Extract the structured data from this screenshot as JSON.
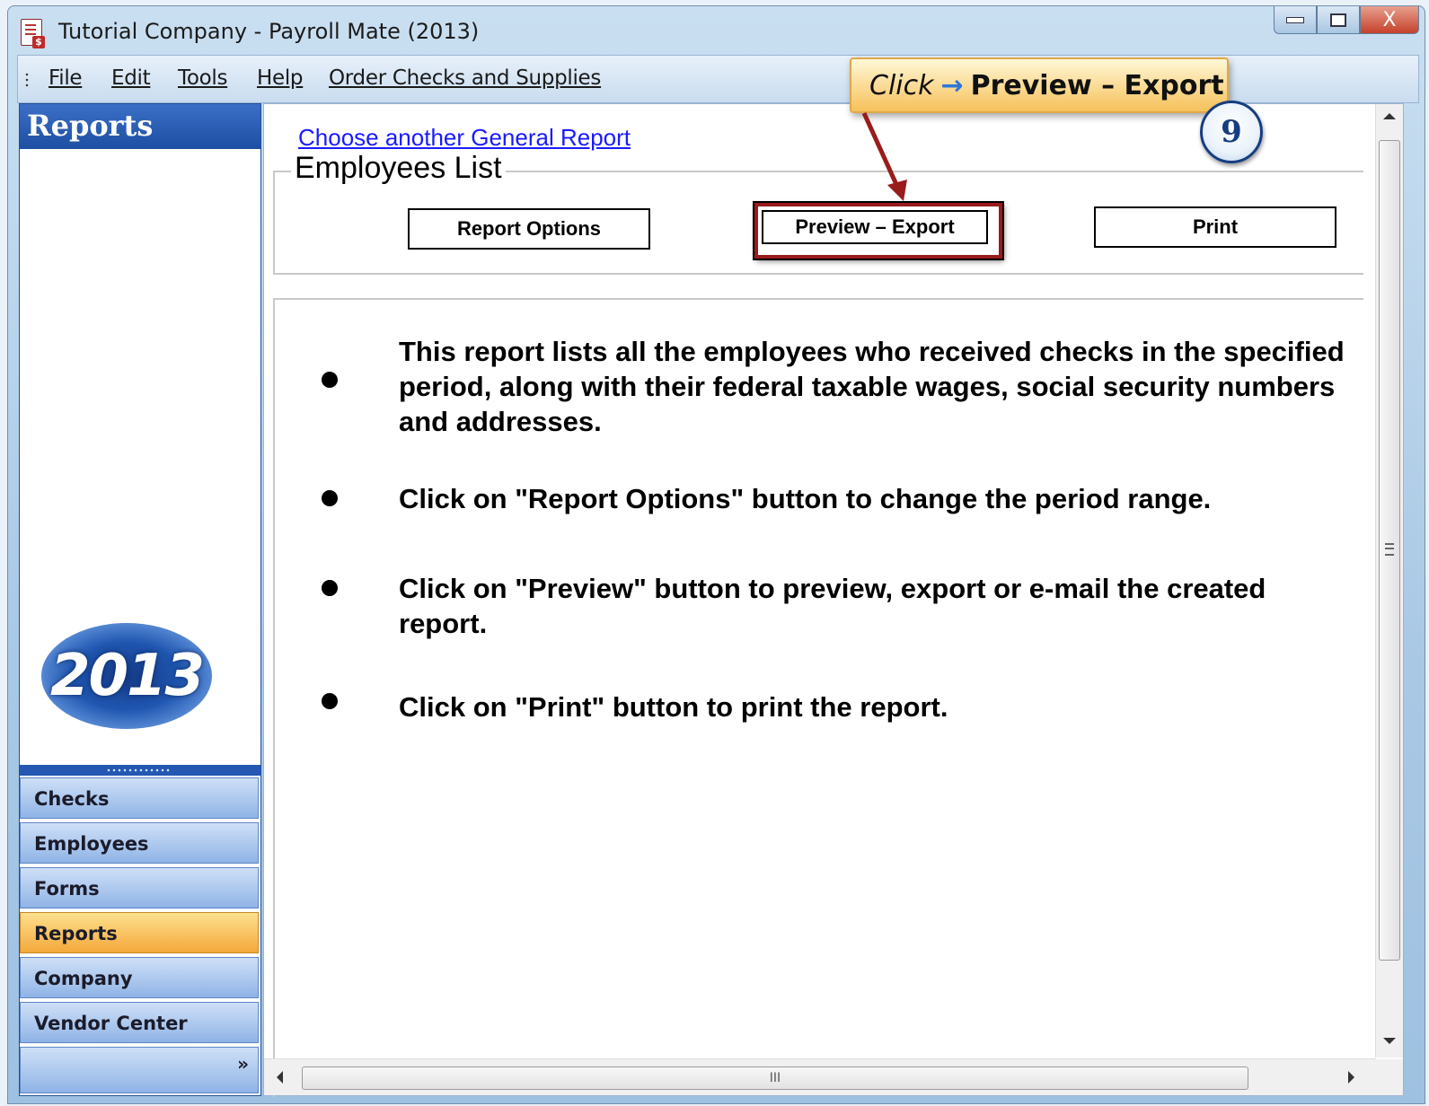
{
  "window": {
    "title": "Tutorial Company - Payroll Mate (2013)",
    "controls": {
      "minimize": "minimize-icon",
      "maximize": "maximize-icon",
      "close": "X"
    }
  },
  "menubar": {
    "items": [
      "File",
      "Edit",
      "Tools",
      "Help",
      "Order Checks and Supplies"
    ]
  },
  "sidebar": {
    "header": "Reports",
    "logo_text": "2013",
    "nav": [
      "Checks",
      "Employees",
      "Forms",
      "Reports",
      "Company",
      "Vendor Center"
    ],
    "active": "Reports",
    "more_icon": "»"
  },
  "content": {
    "link": "Choose another General Report",
    "group_title": "Employees List",
    "buttons": {
      "report_options": "Report Options",
      "preview_export": "Preview – Export",
      "print": "Print"
    },
    "descriptions": [
      "This report lists all the employees who received checks in the specified period, along with their federal taxable wages, social security numbers and addresses.",
      "Click on \"Report Options\" button to change the period range.",
      "Click on \"Preview\" button to preview, export or e-mail the created report.",
      "Click on \"Print\" button to print the report."
    ],
    "hscroll_grip": "III"
  },
  "callout": {
    "click": "Click",
    "arrow": "→",
    "target": "Preview – Export",
    "step": "9"
  },
  "colors": {
    "active_nav": "#f4a83a",
    "highlight_border": "#9a1b1b",
    "callout_bg": "#f6c15a",
    "link": "#1a1aff"
  }
}
